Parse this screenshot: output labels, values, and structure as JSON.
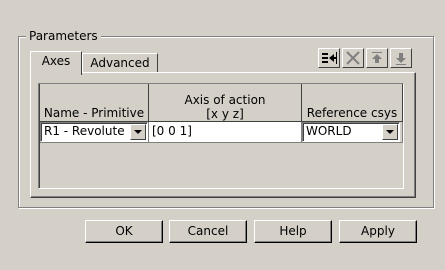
{
  "group": {
    "title": "Parameters"
  },
  "tabs": [
    {
      "label": "Axes",
      "active": true
    },
    {
      "label": "Advanced",
      "active": false
    }
  ],
  "toolbar": {
    "icons": [
      "insert-row-icon",
      "delete-row-icon",
      "move-up-icon",
      "move-down-icon"
    ]
  },
  "table": {
    "headers": [
      {
        "line1": "Name - Primitive",
        "line2": ""
      },
      {
        "line1": "Axis of action",
        "line2": "[x y z]"
      },
      {
        "line1": "Reference csys",
        "line2": ""
      }
    ],
    "rows": [
      {
        "name": "R1 - Revolute",
        "axis": "[0 0 1]",
        "csys": "WORLD"
      }
    ]
  },
  "buttons": {
    "ok": "OK",
    "cancel": "Cancel",
    "help": "Help",
    "apply": "Apply"
  }
}
